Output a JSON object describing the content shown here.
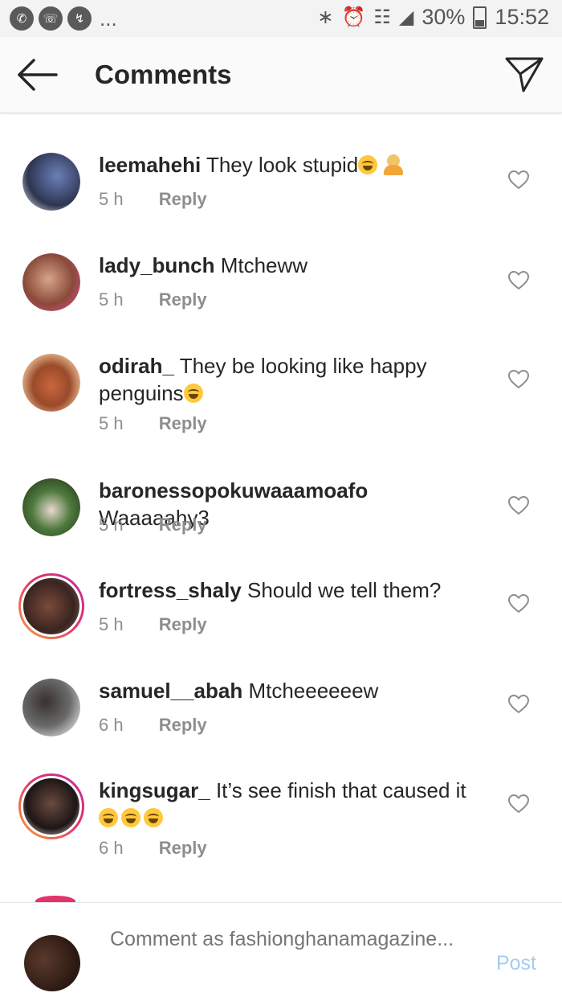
{
  "status_bar": {
    "left_icons": [
      "whatsapp-icon",
      "phone-icon",
      "messenger-icon"
    ],
    "more": "...",
    "battery": "30%",
    "time": "15:52"
  },
  "header": {
    "title": "Comments"
  },
  "comments": [
    {
      "username": "leemahehi",
      "text": "They look stupid",
      "time": "5 h",
      "reply": "Reply",
      "emoji": [
        "face-with-tears-of-joy",
        "person-gesturing-no"
      ],
      "story_ring": false
    },
    {
      "username": "lady_bunch",
      "text": "Mtcheww",
      "time": "5 h",
      "reply": "Reply",
      "emoji": [],
      "story_ring": false
    },
    {
      "username": "odirah_",
      "text": "They be looking like happy penguins",
      "time": "5 h",
      "reply": "Reply",
      "emoji": [
        "face-with-tears-of-joy"
      ],
      "story_ring": false
    },
    {
      "username": "baronessopokuwaaamoafo",
      "text": "Waaaaahy3",
      "time": "5 h",
      "reply": "Reply",
      "emoji": [],
      "story_ring": false
    },
    {
      "username": "fortress_shaly",
      "text": "Should we tell them?",
      "time": "5 h",
      "reply": "Reply",
      "emoji": [],
      "story_ring": true
    },
    {
      "username": "samuel__abah",
      "text": "Mtcheeeeeew",
      "time": "6 h",
      "reply": "Reply",
      "emoji": [],
      "story_ring": false
    },
    {
      "username": "kingsugar_",
      "text": "It’s see finish that caused it",
      "time": "6 h",
      "reply": "Reply",
      "emoji": [
        "face-with-tears-of-joy",
        "face-with-tears-of-joy",
        "face-with-tears-of-joy"
      ],
      "story_ring": true
    }
  ],
  "composer": {
    "placeholder": "Comment as fashionghanamagazine...",
    "post_label": "Post"
  },
  "colors": {
    "link": "#a4cdf2",
    "meta": "#8e8e8e",
    "text": "#262626"
  }
}
